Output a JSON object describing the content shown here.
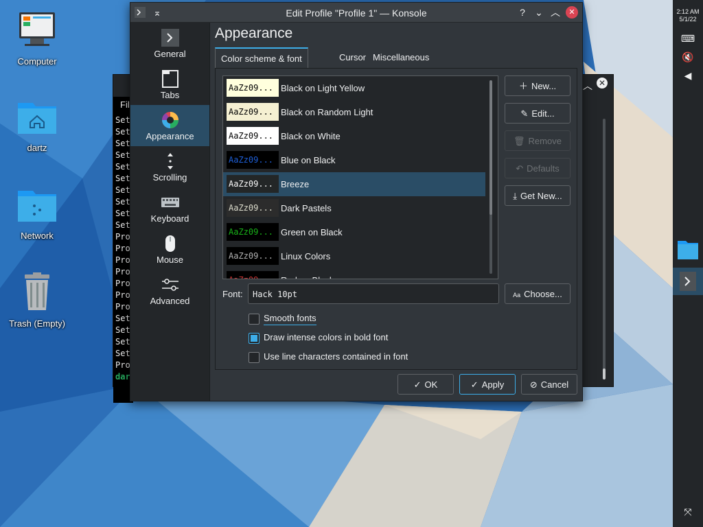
{
  "desktop": {
    "icons": [
      {
        "label": "Computer"
      },
      {
        "label": "dartz"
      },
      {
        "label": "Network"
      },
      {
        "label": "Trash (Empty)"
      }
    ]
  },
  "panel": {
    "time": "2:12 AM",
    "date": "5/1/22",
    "tray": [
      "keyboard-icon",
      "speaker-muted-icon",
      "arrow-left-icon"
    ]
  },
  "bg_konsole": {
    "menu": "Fil",
    "lines": [
      "Set",
      "Set",
      "Set",
      "Set",
      "Set",
      "Set",
      "Set",
      "Set",
      "Set",
      "Set",
      "Pro",
      "Pro",
      "Pro",
      "Pro",
      "Pro",
      "Pro",
      "Pro",
      "Set",
      "Set",
      "Set",
      "Set",
      "Pro",
      "dar"
    ]
  },
  "dialog": {
    "title": "Edit Profile \"Profile 1\" — Konsole",
    "sidebar": [
      {
        "label": "General",
        "icon": "terminal-icon"
      },
      {
        "label": "Tabs",
        "icon": "tabs-icon"
      },
      {
        "label": "Appearance",
        "icon": "color-wheel-icon"
      },
      {
        "label": "Scrolling",
        "icon": "scroll-arrows-icon"
      },
      {
        "label": "Keyboard",
        "icon": "keyboard-icon"
      },
      {
        "label": "Mouse",
        "icon": "mouse-icon"
      },
      {
        "label": "Advanced",
        "icon": "sliders-icon"
      }
    ],
    "page_title": "Appearance",
    "tabs": [
      "Color scheme & font",
      "Cursor",
      "Miscellaneous"
    ],
    "preview_text": "AaZz09...",
    "schemes": [
      {
        "name": "Black on Light Yellow",
        "bg": "#ffffdd",
        "fg": "#000000"
      },
      {
        "name": "Black on Random Light",
        "bg": "#f5f0d2",
        "fg": "#000000"
      },
      {
        "name": "Black on White",
        "bg": "#ffffff",
        "fg": "#000000"
      },
      {
        "name": "Blue on Black",
        "bg": "#000000",
        "fg": "#1e5fd8"
      },
      {
        "name": "Breeze",
        "bg": "#232627",
        "fg": "#fcfcfc"
      },
      {
        "name": "Dark Pastels",
        "bg": "#2c2c2c",
        "fg": "#dcdccc"
      },
      {
        "name": "Green on Black",
        "bg": "#000000",
        "fg": "#18b218"
      },
      {
        "name": "Linux Colors",
        "bg": "#000000",
        "fg": "#b2b2b2"
      },
      {
        "name": "Red on Black",
        "bg": "#000000",
        "fg": "#cc3333"
      }
    ],
    "selected_scheme": "Breeze",
    "buttons": {
      "new": "New...",
      "edit": "Edit...",
      "remove": "Remove",
      "defaults": "Defaults",
      "get_new": "Get New...",
      "choose": "Choose..."
    },
    "font_label": "Font:",
    "font_value": "Hack 10pt",
    "checkboxes": [
      {
        "label": "Smooth fonts",
        "checked": false
      },
      {
        "label": "Draw intense colors in bold font",
        "checked": true
      },
      {
        "label": "Use line characters contained in font",
        "checked": false
      }
    ],
    "footer": {
      "ok": "OK",
      "apply": "Apply",
      "cancel": "Cancel"
    }
  }
}
